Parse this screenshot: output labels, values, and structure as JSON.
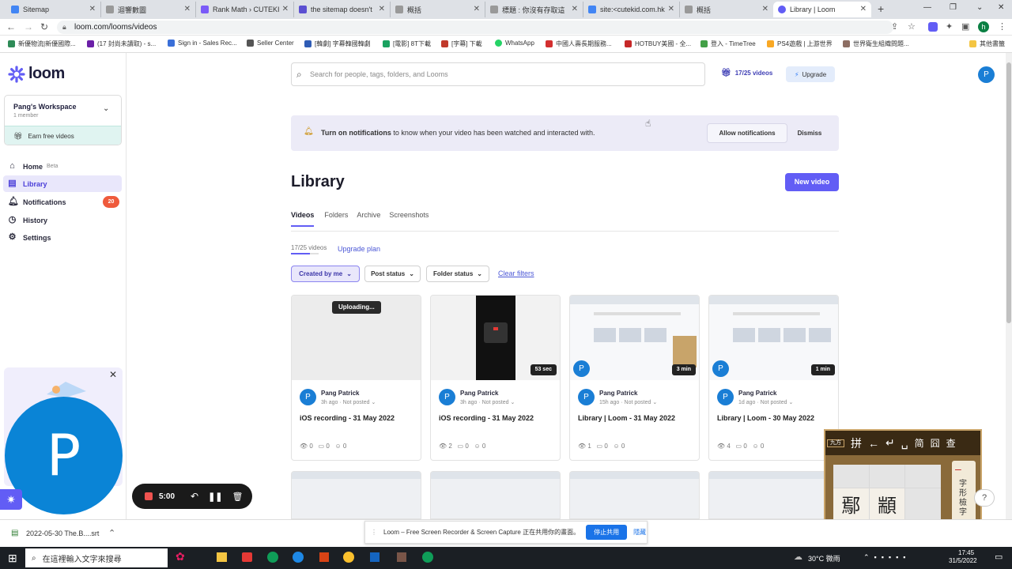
{
  "browser": {
    "tabs": [
      {
        "title": "Sitemap",
        "color": "#4285f4"
      },
      {
        "title": "迴響數圖",
        "color": "#999"
      },
      {
        "title": "Rank Math › CUTEKI",
        "color": "#7a5af8"
      },
      {
        "title": "the sitemap doesn't",
        "color": "#5b4fd1"
      },
      {
        "title": "概括",
        "color": "#999"
      },
      {
        "title": "標題 : 你沒有存取這",
        "color": "#999"
      },
      {
        "title": "site:<cutekid.com.hk",
        "color": "#4285f4"
      },
      {
        "title": "概括",
        "color": "#999"
      },
      {
        "title": "Library | Loom",
        "color": "#625df5",
        "active": true
      }
    ],
    "url": "loom.com/looms/videos",
    "bookmarks": [
      "新優物流|新優國際...",
      "(17 封尚未讀取) - s...",
      "Sign in - Sales Rec...",
      "Seller Center",
      "[韓劇] 字幕韓國韓劇",
      "[電影] 8T下載",
      "[字幕] 下載",
      "WhatsApp",
      "中國人壽長期服務...",
      "HOTBUY美國 - 全...",
      "登入 - TimeTree",
      "PS4遊戲 | 上游世界",
      "世界衛生組織問題...",
      "其他書籤"
    ],
    "avatar_letter": "h"
  },
  "sidebar": {
    "logo": "loom",
    "workspace_name": "Pang's Workspace",
    "workspace_members": "1 member",
    "earn_label": "Earn free videos",
    "nav": [
      {
        "label": "Home",
        "badge_text": "Beta",
        "icon": "home-icon"
      },
      {
        "label": "Library",
        "icon": "library-icon",
        "active": true
      },
      {
        "label": "Notifications",
        "count": "20",
        "icon": "bell-icon"
      },
      {
        "label": "History",
        "icon": "clock-icon"
      },
      {
        "label": "Settings",
        "icon": "gear-icon"
      }
    ]
  },
  "topbar": {
    "search_placeholder": "Search for people, tags, folders, and Looms",
    "video_count": "17/25 videos",
    "upgrade": "Upgrade",
    "user_initial": "P"
  },
  "notice": {
    "bold": "Turn on notifications",
    "text": " to know when your video has been watched and interacted with.",
    "allow": "Allow notifications",
    "dismiss": "Dismiss"
  },
  "library": {
    "title": "Library",
    "new_video": "New video",
    "tabs": [
      "Videos",
      "Folders",
      "Archive",
      "Screenshots"
    ],
    "usage": "17/25 videos",
    "usage_fraction": 0.68,
    "upgrade_plan": "Upgrade plan",
    "filters": [
      "Created by me",
      "Post status",
      "Folder status"
    ],
    "clear_filters": "Clear filters"
  },
  "cards": [
    {
      "author": "Pang Patrick",
      "meta": "3h ago · Not posted",
      "title": "iOS recording - 31 May 2022",
      "badge": "Uploading...",
      "views": "0",
      "comments": "0",
      "reactions": "0"
    },
    {
      "author": "Pang Patrick",
      "meta": "3h ago · Not posted",
      "title": "iOS recording - 31 May 2022",
      "duration": "53 sec",
      "views": "2",
      "comments": "0",
      "reactions": "0"
    },
    {
      "author": "Pang Patrick",
      "meta": "15h ago · Not posted",
      "title": "Library | Loom - 31 May 2022",
      "duration": "3 min",
      "views": "1",
      "comments": "0",
      "reactions": "0"
    },
    {
      "author": "Pang Patrick",
      "meta": "1d ago · Not posted",
      "title": "Library | Loom - 30 May 2022",
      "duration": "1 min",
      "views": "4",
      "comments": "0",
      "reactions": "0"
    }
  ],
  "recorder": {
    "timer": "5:00",
    "cam_initial": "P"
  },
  "ime": {
    "labels": [
      "九方",
      "拼",
      "←",
      "↵",
      "␣",
      "简",
      "囧",
      "查"
    ],
    "side_chars": "字形檢字",
    "chars": [
      "鄢",
      "顓"
    ]
  },
  "share_bar": {
    "text": "Loom – Free Screen Recorder & Screen Capture 正在共用你的畫面。",
    "stop": "停止共用",
    "hide": "隱藏"
  },
  "download": {
    "file": "2022-05-30 The.B....srt"
  },
  "taskbar": {
    "search": "在這裡輸入文字來搜尋",
    "weather": "30°C 微雨",
    "time": "17:45",
    "date": "31/5/2022"
  }
}
